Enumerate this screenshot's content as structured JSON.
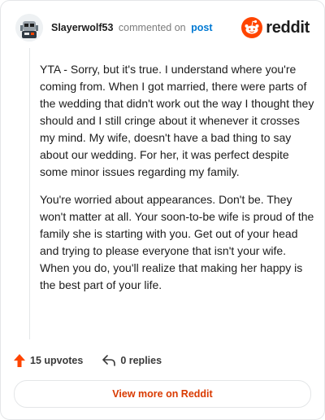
{
  "comment": {
    "username": "Slayerwolf53",
    "action": "commented on",
    "post_link": "post",
    "paragraphs": [
      "YTA - Sorry, but it's true. I understand where you're coming from. When I got married, there were parts of the wedding that didn't work out the way I thought they should and I still cringe about it whenever it crosses my mind. My wife, doesn't have a bad thing to say about our wedding. For her, it was perfect despite some minor issues regarding my family.",
      "You're worried about appearances. Don't be. They won't matter at all. Your soon-to-be wife is proud of the family she is starting with you. Get out of your head and trying to please everyone that isn't your wife. When you do, you'll realize that making her happy is the best part of your life."
    ],
    "upvotes": "15 upvotes",
    "replies": "0 replies"
  },
  "brand": {
    "wordmark": "reddit",
    "color": "#ff4500"
  },
  "cta": {
    "label": "View more on Reddit"
  },
  "colors": {
    "link": "#0079d3",
    "cta_text": "#d93a00",
    "upvote": "#ff4500"
  },
  "icons": [
    "avatar",
    "reddit-logo-icon",
    "upvote-arrow-icon",
    "reply-arrow-icon"
  ]
}
